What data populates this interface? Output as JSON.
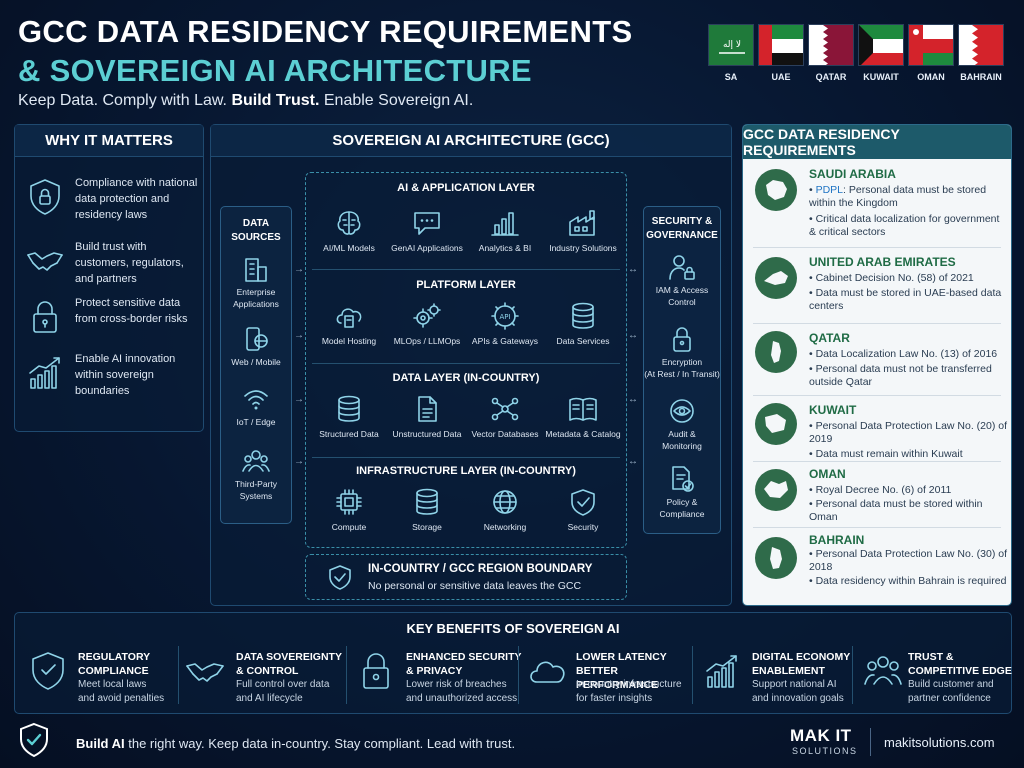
{
  "header": {
    "title_line1": "GCC DATA RESIDENCY REQUIREMENTS",
    "title_line2": "& SOVEREIGN AI ARCHITECTURE",
    "subtitle_a": "Keep Data. Comply with Law. ",
    "subtitle_b": "Build Trust.",
    "subtitle_c": " Enable Sovereign AI."
  },
  "flags": [
    {
      "label": "SA",
      "icon": "saudi-flag"
    },
    {
      "label": "UAE",
      "icon": "uae-flag"
    },
    {
      "label": "QATAR",
      "icon": "qatar-flag"
    },
    {
      "label": "KUWAIT",
      "icon": "kuwait-flag"
    },
    {
      "label": "OMAN",
      "icon": "oman-flag"
    },
    {
      "label": "BAHRAIN",
      "icon": "bahrain-flag"
    }
  ],
  "why": {
    "title": "WHY IT MATTERS",
    "items": [
      {
        "text": "Compliance with national data protection and residency laws",
        "icon": "shield-lock-icon"
      },
      {
        "text": "Build trust with customers, regulators, and partners",
        "icon": "handshake-icon"
      },
      {
        "text": "Protect sensitive data from cross-border risks",
        "icon": "padlock-icon"
      },
      {
        "text": "Enable AI innovation within sovereign boundaries",
        "icon": "growth-chart-icon"
      }
    ]
  },
  "arch": {
    "title": "SOVEREIGN AI ARCHITECTURE (GCC)",
    "sources_title_1": "DATA",
    "sources_title_2": "SOURCES",
    "sources": [
      {
        "label_1": "Enterprise",
        "label_2": "Applications",
        "icon": "building-icon"
      },
      {
        "label_1": "Web / Mobile",
        "label_2": "",
        "icon": "mobile-globe-icon"
      },
      {
        "label_1": "IoT / Edge",
        "label_2": "",
        "icon": "wifi-icon"
      },
      {
        "label_1": "Third-Party",
        "label_2": "Systems",
        "icon": "people-icon"
      }
    ],
    "layers": [
      {
        "title": "AI & APPLICATION LAYER",
        "items": [
          "AI/ML Models",
          "GenAI Applications",
          "Analytics & BI",
          "Industry Solutions"
        ]
      },
      {
        "title": "PLATFORM LAYER",
        "items": [
          "Model Hosting",
          "MLOps / LLMOps",
          "APIs & Gateways",
          "Data Services"
        ]
      },
      {
        "title": "DATA LAYER (IN-COUNTRY)",
        "items": [
          "Structured Data",
          "Unstructured Data",
          "Vector Databases",
          "Metadata & Catalog"
        ]
      },
      {
        "title": "INFRASTRUCTURE LAYER (IN-COUNTRY)",
        "items": [
          "Compute",
          "Storage",
          "Networking",
          "Security"
        ]
      }
    ],
    "api_text": "API",
    "security_title_1": "SECURITY &",
    "security_title_2": "GOVERNANCE",
    "security": [
      {
        "label_1": "IAM & Access",
        "label_2": "Control",
        "icon": "user-lock-icon"
      },
      {
        "label_1": "Encryption",
        "label_2": "(At Rest / In Transit)",
        "icon": "padlock-icon"
      },
      {
        "label_1": "Audit &",
        "label_2": "Monitoring",
        "icon": "eye-icon"
      },
      {
        "label_1": "Policy &",
        "label_2": "Compliance",
        "icon": "document-check-icon"
      }
    ],
    "boundary_title": "IN-COUNTRY / GCC REGION BOUNDARY",
    "boundary_sub": "No personal or sensitive data leaves the GCC"
  },
  "requirements": {
    "title": "GCC DATA RESIDENCY REQUIREMENTS",
    "countries": [
      {
        "name": "SAUDI ARABIA",
        "link": "PDPL",
        "lines": [
          ": Personal data must be stored within the Kingdom",
          "Critical data localization for government & critical sectors"
        ]
      },
      {
        "name": "UNITED ARAB EMIRATES",
        "lines": [
          "Cabinet Decision No. (58) of 2021",
          "Data must be stored in UAE-based data centers"
        ]
      },
      {
        "name": "QATAR",
        "lines": [
          "Data Localization Law No. (13) of 2016",
          "Personal data must not be transferred outside Qatar"
        ]
      },
      {
        "name": "KUWAIT",
        "lines": [
          "Personal Data Protection Law No. (20) of 2019",
          "Data must remain within Kuwait"
        ]
      },
      {
        "name": "OMAN",
        "lines": [
          "Royal Decree No. (6) of 2011",
          "Personal data must be stored within Oman"
        ]
      },
      {
        "name": "BAHRAIN",
        "lines": [
          "Personal Data Protection Law No. (30) of 2018",
          "Data residency within Bahrain is required"
        ]
      }
    ]
  },
  "benefits": {
    "title": "KEY BENEFITS OF SOVEREIGN AI",
    "items": [
      {
        "title_1": "REGULATORY",
        "title_2": "COMPLIANCE",
        "desc_1": "Meet local laws",
        "desc_2": "and avoid penalties",
        "icon": "shield-icon"
      },
      {
        "title_1": "DATA SOVEREIGNTY",
        "title_2": "& CONTROL",
        "desc_1": "Full control over data",
        "desc_2": "and AI lifecycle",
        "icon": "handshake-icon"
      },
      {
        "title_1": "ENHANCED SECURITY",
        "title_2": "& PRIVACY",
        "desc_1": "Lower risk of breaches",
        "desc_2": "and unauthorized access",
        "icon": "padlock-icon"
      },
      {
        "title_1": "LOWER LATENCY",
        "title_2": "BETTER PERFORMANCE",
        "desc_1": "In-country infrastructure",
        "desc_2": "for faster insights",
        "icon": "cloud-icon"
      },
      {
        "title_1": "DIGITAL ECONOMY",
        "title_2": "ENABLEMENT",
        "desc_1": "Support national AI",
        "desc_2": "and innovation goals",
        "icon": "growth-chart-icon"
      },
      {
        "title_1": "TRUST &",
        "title_2": "COMPETITIVE EDGE",
        "desc_1": "Build customer and",
        "desc_2": "partner confidence",
        "icon": "people-icon"
      }
    ]
  },
  "footer": {
    "tag_bold": "Build AI",
    "tag_rest": " the right way. Keep data in-country. Stay compliant. Lead with trust.",
    "brand_1": "MAK IT",
    "brand_2": "SOLUTIONS",
    "site": "makitsolutions.com"
  },
  "colors": {
    "accent": "#5ccfd3",
    "background": "#071731",
    "country_green": "#1f6b45"
  }
}
